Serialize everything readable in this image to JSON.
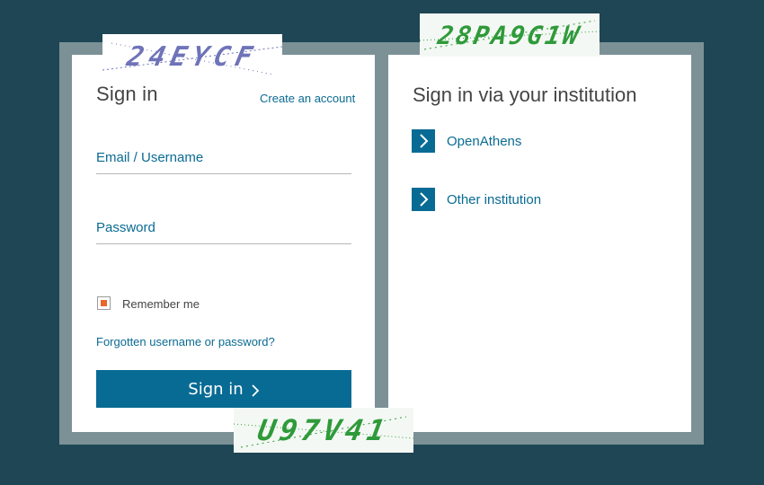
{
  "left_panel": {
    "title": "Sign in",
    "create_account": "Create an account",
    "email_label": "Email / Username",
    "email_value": "",
    "password_label": "Password",
    "password_value": "",
    "remember_label": "Remember me",
    "remember_checked": true,
    "forgot_link": "Forgotten username or password?",
    "signin_button": "Sign in"
  },
  "right_panel": {
    "title": "Sign in via your institution",
    "options": [
      {
        "label": "OpenAthens",
        "icon": "chevron-right-icon"
      },
      {
        "label": "Other institution",
        "icon": "chevron-right-icon"
      }
    ]
  },
  "captchas": [
    {
      "text": "24EYCF",
      "color": "#6f73b8"
    },
    {
      "text": "28PA9G1W",
      "color": "#2f9a3a"
    },
    {
      "text": "U97V41",
      "color": "#2f9a3a"
    }
  ],
  "colors": {
    "background": "#1e4655",
    "frame": "#7b9196",
    "accent": "#086b94",
    "link": "#0a6b92",
    "checkbox_fill": "#e8672a"
  }
}
